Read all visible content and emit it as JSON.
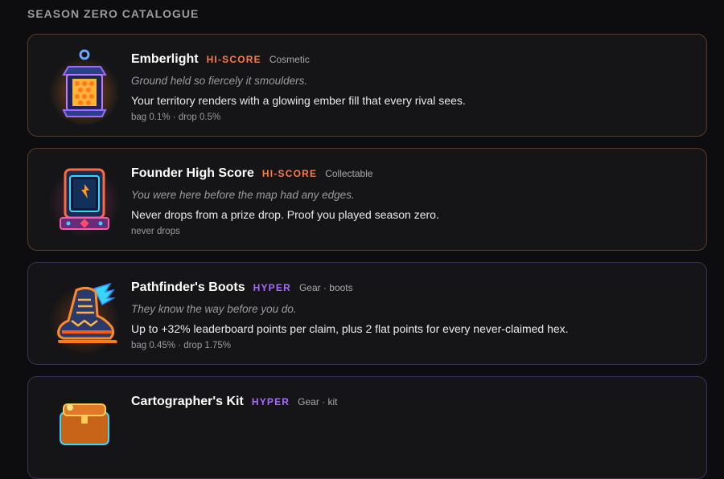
{
  "section": {
    "title": "SEASON ZERO CATALOGUE"
  },
  "items": [
    {
      "name": "Emberlight",
      "rarity": "HI-SCORE",
      "category": "Cosmetic",
      "flavor": "Ground held so fiercely it smoulders.",
      "description": "Your territory renders with a glowing ember fill that every rival sees.",
      "odds": "bag 0.1% · drop 0.5%",
      "icon": "lantern-icon"
    },
    {
      "name": "Founder High Score",
      "rarity": "HI-SCORE",
      "category": "Collectable",
      "flavor": "You were here before the map had any edges.",
      "description": "Never drops from a prize drop. Proof you played season zero.",
      "odds": "never drops",
      "icon": "arcade-trophy-icon"
    },
    {
      "name": "Pathfinder's Boots",
      "rarity": "HYPER",
      "category": "Gear · boots",
      "flavor": "They know the way before you do.",
      "description": "Up to +32% leaderboard points per claim, plus 2 flat points for every never-claimed hex.",
      "odds": "bag 0.45% · drop 1.75%",
      "icon": "winged-boot-icon"
    },
    {
      "name": "Cartographer's Kit",
      "rarity": "HYPER",
      "category": "Gear · kit",
      "icon": "treasure-kit-icon"
    }
  ],
  "colors": {
    "background": "#0d0d0f",
    "card": "#151517",
    "hiscore": "#ff7a45",
    "hyper": "#a96bff",
    "border_hiscore": "#5b3b28",
    "border_hyper": "#3b2f5a"
  }
}
